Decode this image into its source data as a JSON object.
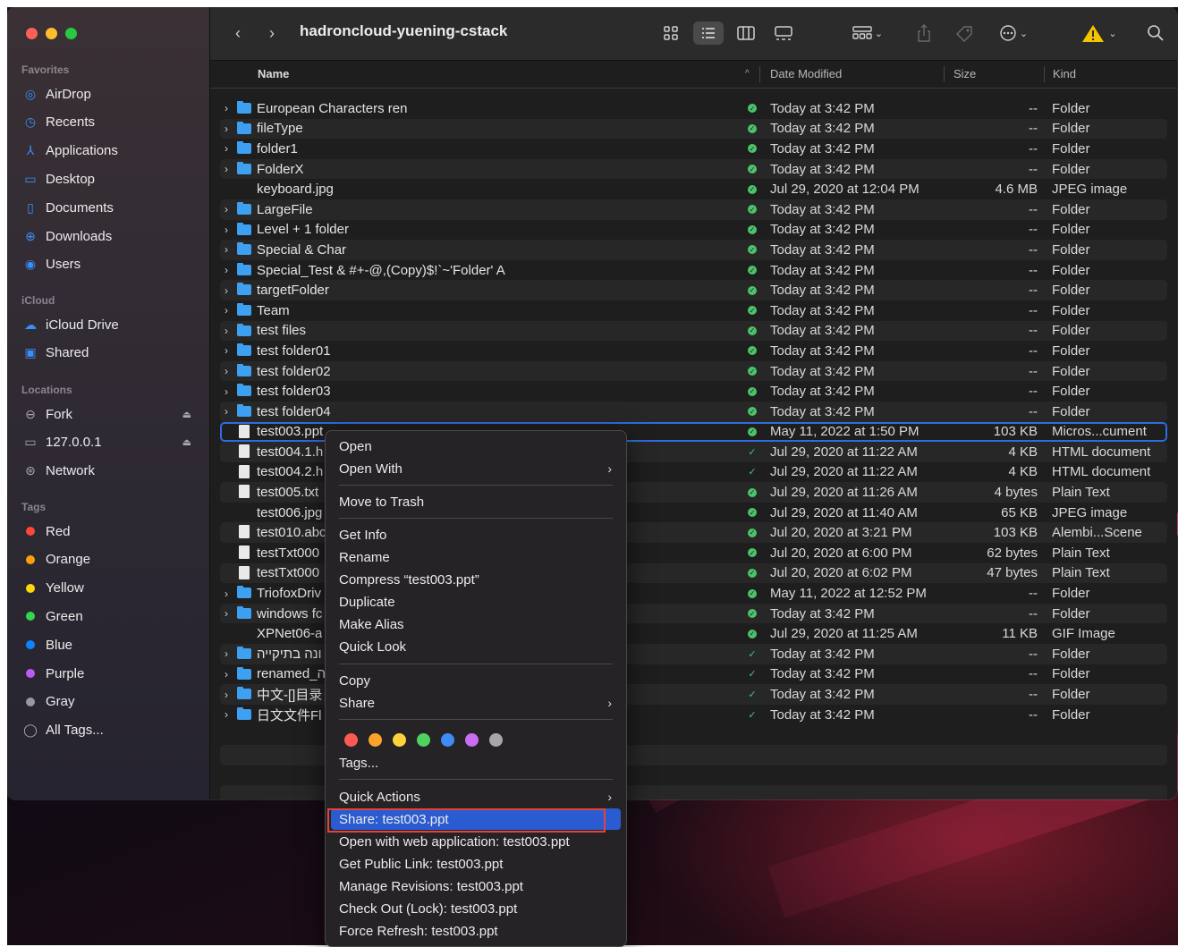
{
  "window": {
    "title": "hadroncloud-yuening-cstack"
  },
  "sidebar": {
    "favorites_label": "Favorites",
    "favorites": [
      {
        "label": "AirDrop",
        "icon": "airdrop-icon"
      },
      {
        "label": "Recents",
        "icon": "clock-icon"
      },
      {
        "label": "Applications",
        "icon": "applications-icon"
      },
      {
        "label": "Desktop",
        "icon": "desktop-icon"
      },
      {
        "label": "Documents",
        "icon": "document-icon"
      },
      {
        "label": "Downloads",
        "icon": "download-icon"
      },
      {
        "label": "Users",
        "icon": "user-icon"
      }
    ],
    "icloud_label": "iCloud",
    "icloud": [
      {
        "label": "iCloud Drive",
        "icon": "cloud-icon"
      },
      {
        "label": "Shared",
        "icon": "shared-folder-icon"
      }
    ],
    "locations_label": "Locations",
    "locations": [
      {
        "label": "Fork",
        "icon": "drive-icon"
      },
      {
        "label": "127.0.0.1",
        "icon": "monitor-icon"
      },
      {
        "label": "Network",
        "icon": "globe-icon"
      }
    ],
    "tags_label": "Tags",
    "tags": [
      {
        "label": "Red",
        "color": "#ff453a"
      },
      {
        "label": "Orange",
        "color": "#ff9f0a"
      },
      {
        "label": "Yellow",
        "color": "#ffd60a"
      },
      {
        "label": "Green",
        "color": "#32d74b"
      },
      {
        "label": "Blue",
        "color": "#0a84ff"
      },
      {
        "label": "Purple",
        "color": "#bf5af2"
      },
      {
        "label": "Gray",
        "color": "#98989d"
      }
    ],
    "all_tags": "All Tags..."
  },
  "columns": {
    "name": "Name",
    "date": "Date Modified",
    "size": "Size",
    "kind": "Kind"
  },
  "files": [
    {
      "name": "European Characters ren",
      "date": "Today at 3:42 PM",
      "size": "--",
      "kind": "Folder",
      "type": "folder",
      "sync": "full"
    },
    {
      "name": "fileType",
      "date": "Today at 3:42 PM",
      "size": "--",
      "kind": "Folder",
      "type": "folder",
      "sync": "full"
    },
    {
      "name": "folder1",
      "date": "Today at 3:42 PM",
      "size": "--",
      "kind": "Folder",
      "type": "folder",
      "sync": "full"
    },
    {
      "name": "FolderX",
      "date": "Today at 3:42 PM",
      "size": "--",
      "kind": "Folder",
      "type": "folder",
      "sync": "full"
    },
    {
      "name": "keyboard.jpg",
      "date": "Jul 29, 2020 at 12:04 PM",
      "size": "4.6 MB",
      "kind": "JPEG image",
      "type": "image",
      "sync": "full"
    },
    {
      "name": "LargeFile",
      "date": "Today at 3:42 PM",
      "size": "--",
      "kind": "Folder",
      "type": "folder",
      "sync": "full"
    },
    {
      "name": "Level + 1 folder",
      "date": "Today at 3:42 PM",
      "size": "--",
      "kind": "Folder",
      "type": "folder",
      "sync": "full"
    },
    {
      "name": "Special & Char",
      "date": "Today at 3:42 PM",
      "size": "--",
      "kind": "Folder",
      "type": "folder",
      "sync": "full"
    },
    {
      "name": "Special_Test & #+-@,(Copy)$!`~'Folder' A",
      "date": "Today at 3:42 PM",
      "size": "--",
      "kind": "Folder",
      "type": "folder",
      "sync": "full"
    },
    {
      "name": "targetFolder",
      "date": "Today at 3:42 PM",
      "size": "--",
      "kind": "Folder",
      "type": "folder",
      "sync": "full"
    },
    {
      "name": "Team",
      "date": "Today at 3:42 PM",
      "size": "--",
      "kind": "Folder",
      "type": "folder",
      "sync": "full"
    },
    {
      "name": "test files",
      "date": "Today at 3:42 PM",
      "size": "--",
      "kind": "Folder",
      "type": "folder",
      "sync": "full"
    },
    {
      "name": "test folder01",
      "date": "Today at 3:42 PM",
      "size": "--",
      "kind": "Folder",
      "type": "folder",
      "sync": "full"
    },
    {
      "name": "test folder02",
      "date": "Today at 3:42 PM",
      "size": "--",
      "kind": "Folder",
      "type": "folder",
      "sync": "full"
    },
    {
      "name": "test folder03",
      "date": "Today at 3:42 PM",
      "size": "--",
      "kind": "Folder",
      "type": "folder",
      "sync": "full"
    },
    {
      "name": "test folder04",
      "date": "Today at 3:42 PM",
      "size": "--",
      "kind": "Folder",
      "type": "folder",
      "sync": "full"
    },
    {
      "name": "test003.ppt",
      "date": "May 11, 2022 at 1:50 PM",
      "size": "103 KB",
      "kind": "Micros...cument",
      "type": "doc",
      "sync": "full",
      "selected": true
    },
    {
      "name": "test004.1.h",
      "date": "Jul 29, 2020 at 11:22 AM",
      "size": "4 KB",
      "kind": "HTML document",
      "type": "doc",
      "sync": "light"
    },
    {
      "name": "test004.2.h",
      "date": "Jul 29, 2020 at 11:22 AM",
      "size": "4 KB",
      "kind": "HTML document",
      "type": "doc",
      "sync": "light"
    },
    {
      "name": "test005.txt",
      "date": "Jul 29, 2020 at 11:26 AM",
      "size": "4 bytes",
      "kind": "Plain Text",
      "type": "doc",
      "sync": "full"
    },
    {
      "name": "test006.jpg",
      "date": "Jul 29, 2020 at 11:40 AM",
      "size": "65 KB",
      "kind": "JPEG image",
      "type": "image",
      "sync": "full"
    },
    {
      "name": "test010.abc",
      "date": "Jul 20, 2020 at 3:21 PM",
      "size": "103 KB",
      "kind": "Alembi...Scene",
      "type": "doc",
      "sync": "full"
    },
    {
      "name": "testTxt000",
      "date": "Jul 20, 2020 at 6:00 PM",
      "size": "62 bytes",
      "kind": "Plain Text",
      "type": "doc",
      "sync": "full"
    },
    {
      "name": "testTxt000",
      "date": "Jul 20, 2020 at 6:02 PM",
      "size": "47 bytes",
      "kind": "Plain Text",
      "type": "doc",
      "sync": "full"
    },
    {
      "name": "TriofoxDriv",
      "date": "May 11, 2022 at 12:52 PM",
      "size": "--",
      "kind": "Folder",
      "type": "folder",
      "sync": "full"
    },
    {
      "name": "windows fc",
      "date": "Today at 3:42 PM",
      "size": "--",
      "kind": "Folder",
      "type": "folder",
      "sync": "full"
    },
    {
      "name": "XPNet06-a",
      "date": "Jul 29, 2020 at 11:25 AM",
      "size": "11 KB",
      "kind": "GIF Image",
      "type": "image",
      "sync": "full"
    },
    {
      "name": "ונה בתיקייה",
      "date": "Today at 3:42 PM",
      "size": "--",
      "kind": "Folder",
      "type": "folder",
      "sync": "light"
    },
    {
      "name": "renamed_ה",
      "date": "Today at 3:42 PM",
      "size": "--",
      "kind": "Folder",
      "type": "folder",
      "sync": "light"
    },
    {
      "name": "中文-[]目录",
      "date": "Today at 3:42 PM",
      "size": "--",
      "kind": "Folder",
      "type": "folder",
      "sync": "light"
    },
    {
      "name": "日文文件Fl",
      "date": "Today at 3:42 PM",
      "size": "--",
      "kind": "Folder",
      "type": "folder",
      "sync": "light"
    }
  ],
  "context_menu": {
    "open": "Open",
    "open_with": "Open With",
    "move_to_trash": "Move to Trash",
    "get_info": "Get Info",
    "rename": "Rename",
    "compress": "Compress “test003.ppt”",
    "duplicate": "Duplicate",
    "make_alias": "Make Alias",
    "quick_look": "Quick Look",
    "copy": "Copy",
    "share": "Share",
    "tag_colors": [
      "#ff5a52",
      "#ffa22b",
      "#ffd23a",
      "#4fd35f",
      "#3f8cf7",
      "#c96ef2",
      "#a7a7a7"
    ],
    "tags": "Tags...",
    "quick_actions": "Quick Actions",
    "share_file": "Share: test003.ppt",
    "open_web": "Open with web application: test003.ppt",
    "public_link": "Get Public Link: test003.ppt",
    "manage_revisions": "Manage Revisions: test003.ppt",
    "check_out": "Check Out (Lock): test003.ppt",
    "force_refresh": "Force Refresh: test003.ppt"
  }
}
